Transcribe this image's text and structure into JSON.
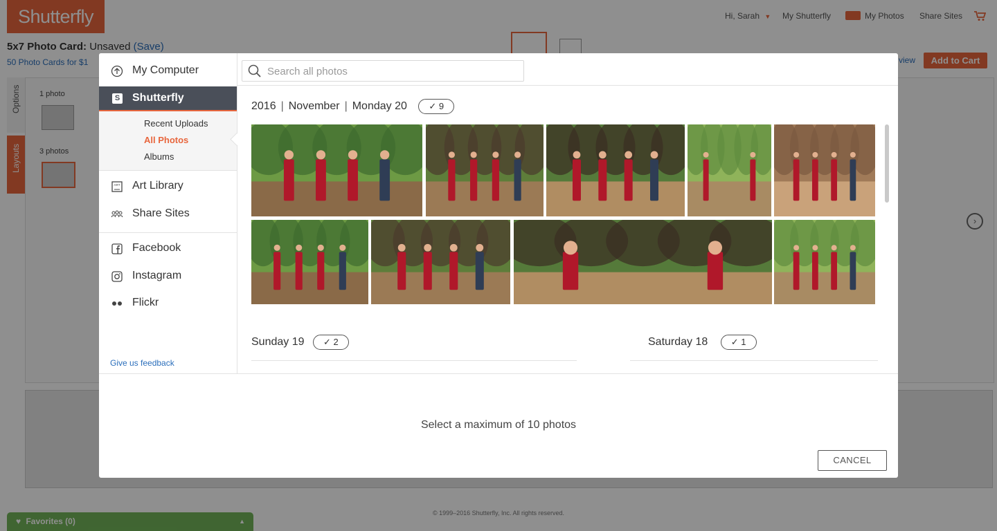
{
  "header": {
    "logo_text": "Shutterfly",
    "greeting": "Hi, Sarah",
    "nav": [
      "My Shutterfly",
      "My Photos",
      "Share Sites"
    ]
  },
  "product": {
    "title": "5x7 Photo Card:",
    "status": "Unsaved",
    "save_label": "(Save)",
    "promo": "50 Photo Cards for $1",
    "preview_label": "view",
    "add_to_cart": "Add to Cart"
  },
  "side_tabs": [
    "Options",
    "Layouts"
  ],
  "layouts": [
    {
      "label": "1 photo"
    },
    {
      "label": "3 photos"
    }
  ],
  "footer": {
    "copyright": "© 1999–2016 Shutterfly, Inc. All rights reserved.",
    "favorites": "Favorites (0)"
  },
  "modal": {
    "sources": [
      {
        "label": "My Computer",
        "icon": "upload-icon"
      },
      {
        "label": "Shutterfly",
        "icon": "shutterfly-icon",
        "active": true
      },
      {
        "label": "Art Library",
        "icon": "art-library-icon"
      },
      {
        "label": "Share Sites",
        "icon": "share-sites-icon"
      },
      {
        "label": "Facebook",
        "icon": "facebook-icon"
      },
      {
        "label": "Instagram",
        "icon": "instagram-icon"
      },
      {
        "label": "Flickr",
        "icon": "flickr-icon"
      }
    ],
    "subnav": [
      "Recent Uploads",
      "All Photos",
      "Albums"
    ],
    "subnav_selected": "All Photos",
    "feedback": "Give us feedback",
    "search_placeholder": "Search all photos",
    "group": {
      "year": "2016",
      "month": "November",
      "day": "Monday 20",
      "count": "9"
    },
    "other_days": [
      {
        "day": "Sunday 19",
        "count": "2"
      },
      {
        "day": "Saturday 18",
        "count": "1"
      }
    ],
    "footer_note": "Select a maximum of 10 photos",
    "cancel_label": "CANCEL"
  },
  "colors": {
    "brand_orange": "#e8663d",
    "active_nav": "#4a4f59",
    "link_blue": "#2a6ebb",
    "favorites_green": "#73b559"
  }
}
